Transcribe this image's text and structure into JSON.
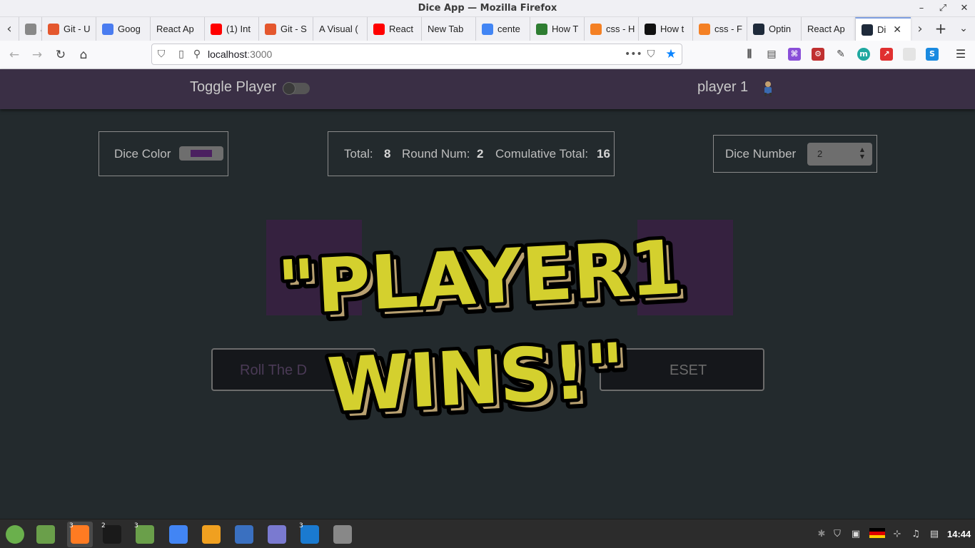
{
  "window": {
    "title": "Dice App — Mozilla Firefox",
    "controls": [
      "–",
      "⤢",
      "✕"
    ]
  },
  "tabs": [
    {
      "label": "asc",
      "icon": "page-icon",
      "color": "#888888"
    },
    {
      "label": "Git - U",
      "icon": "git-icon",
      "color": "#e4572e"
    },
    {
      "label": "Goog",
      "icon": "google-translate-icon",
      "color": "#4a7cf0"
    },
    {
      "label": "React Ap",
      "icon": "",
      "color": ""
    },
    {
      "label": "(1) Int",
      "icon": "youtube-icon",
      "color": "#ff0000"
    },
    {
      "label": "Git - S",
      "icon": "git-icon",
      "color": "#e4572e"
    },
    {
      "label": "A Visual (",
      "icon": "",
      "color": ""
    },
    {
      "label": "React",
      "icon": "youtube-icon",
      "color": "#ff0000"
    },
    {
      "label": "New Tab",
      "icon": "",
      "color": ""
    },
    {
      "label": "cente",
      "icon": "google-icon",
      "color": "#4285f4"
    },
    {
      "label": "How T",
      "icon": "wikihow-icon",
      "color": "#2e7d32"
    },
    {
      "label": "css - H",
      "icon": "stackoverflow-icon",
      "color": "#f48024"
    },
    {
      "label": "How t",
      "icon": "r-icon",
      "color": "#111111"
    },
    {
      "label": "css - F",
      "icon": "stackoverflow-icon",
      "color": "#f48024"
    },
    {
      "label": "Optin",
      "icon": "react-icon",
      "color": "#1e2a3a"
    },
    {
      "label": "React Ap",
      "icon": "",
      "color": ""
    },
    {
      "label": "Di",
      "icon": "react-icon",
      "color": "#1e2a3a",
      "active": true
    }
  ],
  "nav": {
    "url_host": "localhost",
    "url_port": ":3000"
  },
  "app": {
    "toggle_label": "Toggle Player",
    "current_player": "player 1",
    "dice_color_label": "Dice Color",
    "dice_color_value": "#4b2060",
    "total_label": "Total:",
    "total_value": "8",
    "round_label": "Round Num:",
    "round_value": "2",
    "cumulative_label": "Comulative Total:",
    "cumulative_value": "16",
    "dice_number_label": "Dice Number",
    "dice_number_value": "2",
    "roll_button": "Roll The D",
    "reset_button": "ESET",
    "winner_line1": "\"PLAYER1",
    "winner_line2": "WINS!\""
  },
  "taskbar": {
    "apps": [
      {
        "name": "mint-menu-icon",
        "color": "#6ab04c",
        "badge": ""
      },
      {
        "name": "files-icon",
        "color": "#6a9f4a",
        "badge": ""
      },
      {
        "name": "firefox-icon",
        "color": "#ff7b22",
        "badge": "3"
      },
      {
        "name": "terminal-icon",
        "color": "#1a1a1a",
        "badge": "2"
      },
      {
        "name": "folder-icon",
        "color": "#6a9f4a",
        "badge": "3"
      },
      {
        "name": "chrome-icon",
        "color": "#4285f4",
        "badge": ""
      },
      {
        "name": "info-icon",
        "color": "#f0a020",
        "badge": ""
      },
      {
        "name": "screenshot-icon",
        "color": "#3a70c0",
        "badge": ""
      },
      {
        "name": "text-editor-icon",
        "color": "#7a7ad0",
        "badge": ""
      },
      {
        "name": "vscode-icon",
        "color": "#1a7ad0",
        "badge": "3"
      },
      {
        "name": "disk-icon",
        "color": "#888888",
        "badge": ""
      }
    ],
    "clock": "14:44"
  }
}
